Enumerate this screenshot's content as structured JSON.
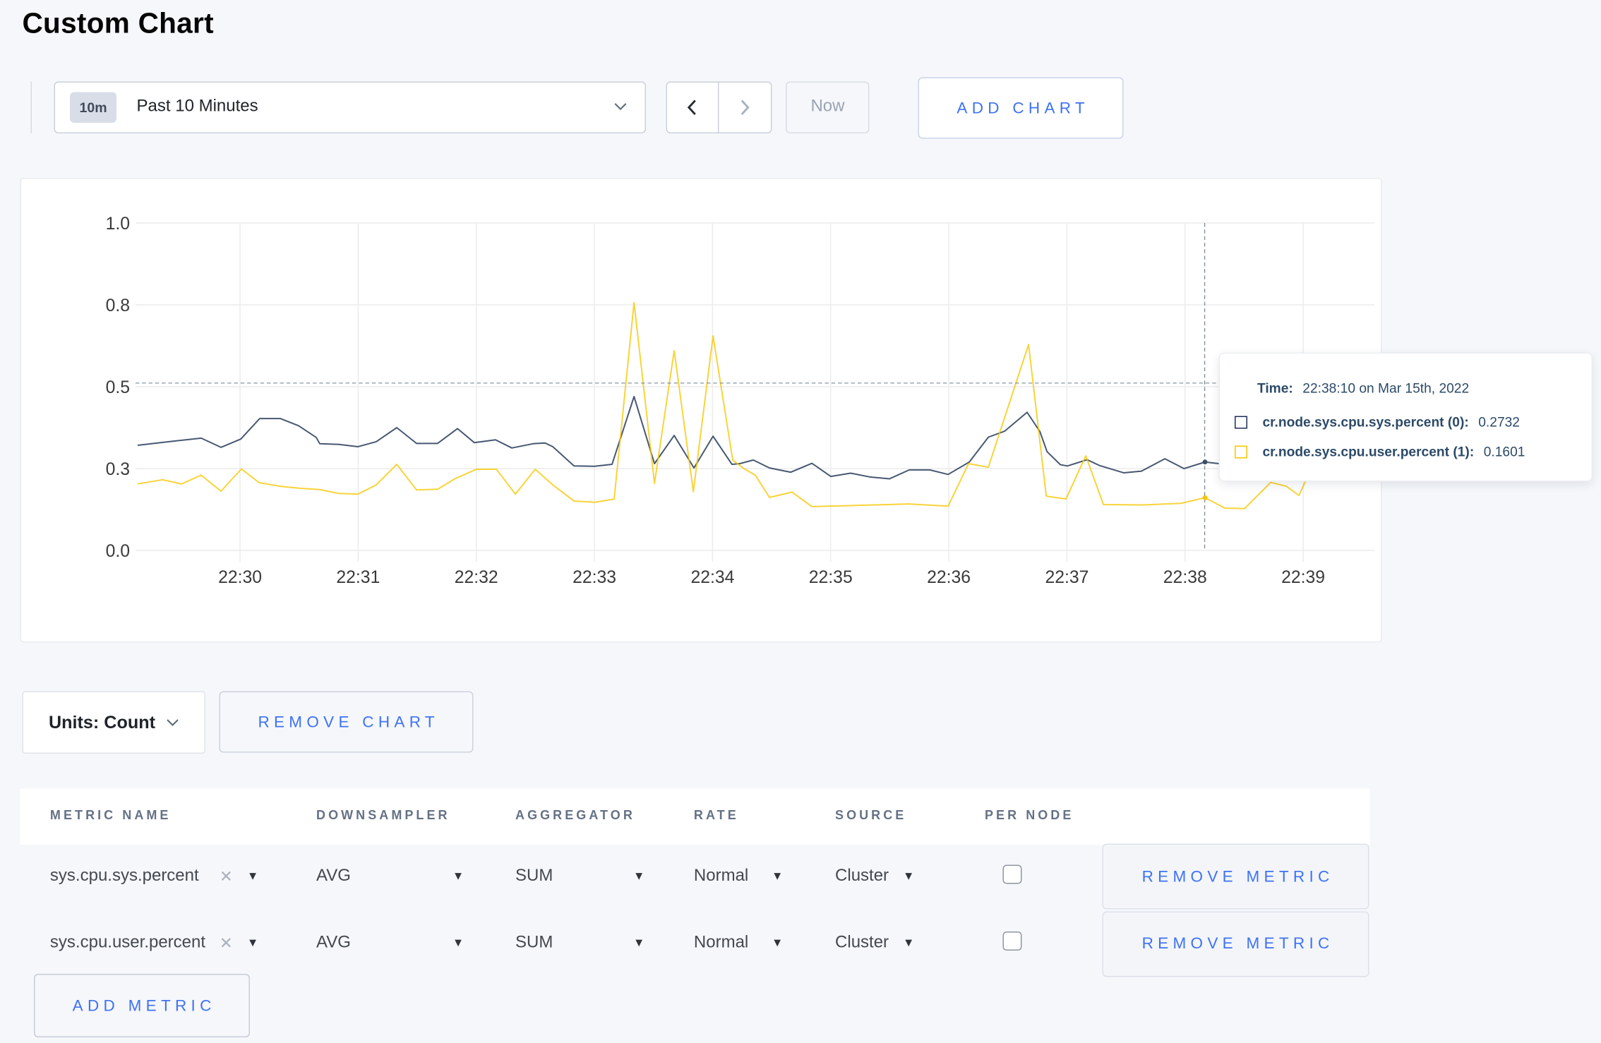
{
  "page": {
    "title": "Custom Chart"
  },
  "controls": {
    "time_badge": "10m",
    "time_label": "Past 10 Minutes",
    "now_label": "Now",
    "add_chart_label": "ADD CHART"
  },
  "chart_data": {
    "type": "line",
    "x_ticks": [
      "22:30",
      "22:31",
      "22:32",
      "22:33",
      "22:34",
      "22:35",
      "22:36",
      "22:37",
      "22:38",
      "22:39"
    ],
    "y_ticks": [
      "0.0",
      "0.3",
      "0.5",
      "0.8",
      "1.0"
    ],
    "ylim": [
      0,
      1
    ],
    "grid": true,
    "crosshair": {
      "time_minutes": 38.1667,
      "hline_value": 0.511
    },
    "series": [
      {
        "name": "cr.node.sys.cpu.sys.percent (0)",
        "color": "#475872",
        "hover_value": 0.2732,
        "points": [
          [
            29.133,
            0.321
          ],
          [
            29.444,
            0.334
          ],
          [
            29.671,
            0.343
          ],
          [
            29.839,
            0.315
          ],
          [
            30.006,
            0.34
          ],
          [
            30.167,
            0.403
          ],
          [
            30.341,
            0.403
          ],
          [
            30.496,
            0.381
          ],
          [
            30.645,
            0.345
          ],
          [
            30.675,
            0.326
          ],
          [
            30.837,
            0.324
          ],
          [
            30.998,
            0.317
          ],
          [
            31.153,
            0.332
          ],
          [
            31.327,
            0.375
          ],
          [
            31.494,
            0.327
          ],
          [
            31.673,
            0.327
          ],
          [
            31.841,
            0.372
          ],
          [
            31.984,
            0.329
          ],
          [
            32.163,
            0.338
          ],
          [
            32.301,
            0.313
          ],
          [
            32.48,
            0.326
          ],
          [
            32.582,
            0.328
          ],
          [
            32.648,
            0.317
          ],
          [
            32.827,
            0.258
          ],
          [
            33.0,
            0.257
          ],
          [
            33.149,
            0.263
          ],
          [
            33.335,
            0.47
          ],
          [
            33.508,
            0.265
          ],
          [
            33.675,
            0.351
          ],
          [
            33.843,
            0.252
          ],
          [
            34.004,
            0.349
          ],
          [
            34.165,
            0.263
          ],
          [
            34.231,
            0.265
          ],
          [
            34.345,
            0.276
          ],
          [
            34.482,
            0.252
          ],
          [
            34.661,
            0.239
          ],
          [
            34.841,
            0.266
          ],
          [
            35.002,
            0.226
          ],
          [
            35.169,
            0.236
          ],
          [
            35.337,
            0.224
          ],
          [
            35.498,
            0.219
          ],
          [
            35.665,
            0.246
          ],
          [
            35.839,
            0.246
          ],
          [
            35.994,
            0.232
          ],
          [
            36.173,
            0.27
          ],
          [
            36.335,
            0.346
          ],
          [
            36.472,
            0.364
          ],
          [
            36.663,
            0.422
          ],
          [
            36.771,
            0.363
          ],
          [
            36.831,
            0.302
          ],
          [
            36.944,
            0.262
          ],
          [
            37.004,
            0.258
          ],
          [
            37.171,
            0.277
          ],
          [
            37.279,
            0.259
          ],
          [
            37.482,
            0.237
          ],
          [
            37.631,
            0.242
          ],
          [
            37.829,
            0.28
          ],
          [
            37.99,
            0.25
          ],
          [
            38.169,
            0.27
          ],
          [
            38.367,
            0.262
          ],
          [
            38.576,
            0.285
          ],
          [
            38.785,
            0.272
          ],
          [
            38.994,
            0.298
          ],
          [
            39.203,
            0.282
          ],
          [
            39.412,
            0.29
          ]
        ]
      },
      {
        "name": "cr.node.sys.cpu.user.percent (1)",
        "color": "#f7c600",
        "hover_value": 0.1601,
        "points": [
          [
            29.133,
            0.203
          ],
          [
            29.343,
            0.216
          ],
          [
            29.504,
            0.203
          ],
          [
            29.671,
            0.23
          ],
          [
            29.839,
            0.181
          ],
          [
            30.012,
            0.249
          ],
          [
            30.161,
            0.207
          ],
          [
            30.341,
            0.196
          ],
          [
            30.496,
            0.19
          ],
          [
            30.675,
            0.186
          ],
          [
            30.837,
            0.174
          ],
          [
            30.998,
            0.172
          ],
          [
            31.153,
            0.2
          ],
          [
            31.327,
            0.263
          ],
          [
            31.494,
            0.185
          ],
          [
            31.673,
            0.187
          ],
          [
            31.823,
            0.22
          ],
          [
            32.002,
            0.248
          ],
          [
            32.17,
            0.248
          ],
          [
            32.331,
            0.172
          ],
          [
            32.498,
            0.248
          ],
          [
            32.648,
            0.2
          ],
          [
            32.827,
            0.151
          ],
          [
            33.006,
            0.147
          ],
          [
            33.167,
            0.157
          ],
          [
            33.335,
            0.757
          ],
          [
            33.508,
            0.205
          ],
          [
            33.675,
            0.61
          ],
          [
            33.837,
            0.179
          ],
          [
            34.004,
            0.655
          ],
          [
            34.171,
            0.276
          ],
          [
            34.261,
            0.251
          ],
          [
            34.363,
            0.23
          ],
          [
            34.482,
            0.162
          ],
          [
            34.673,
            0.178
          ],
          [
            34.841,
            0.134
          ],
          [
            34.99,
            0.135
          ],
          [
            35.66,
            0.142
          ],
          [
            35.994,
            0.135
          ],
          [
            36.167,
            0.265
          ],
          [
            36.335,
            0.254
          ],
          [
            36.675,
            0.629
          ],
          [
            36.825,
            0.166
          ],
          [
            36.992,
            0.157
          ],
          [
            37.159,
            0.289
          ],
          [
            37.309,
            0.14
          ],
          [
            37.649,
            0.139
          ],
          [
            37.966,
            0.144
          ],
          [
            38.169,
            0.161
          ],
          [
            38.337,
            0.129
          ],
          [
            38.504,
            0.128
          ],
          [
            38.725,
            0.208
          ],
          [
            38.857,
            0.196
          ],
          [
            38.964,
            0.168
          ],
          [
            39.072,
            0.252
          ],
          [
            39.203,
            0.295
          ],
          [
            39.412,
            0.27
          ]
        ]
      }
    ]
  },
  "tooltip": {
    "time_label": "Time:",
    "time_value": "22:38:10 on Mar 15th, 2022",
    "rows": [
      {
        "label": "cr.node.sys.cpu.sys.percent (0):",
        "value": "0.2732"
      },
      {
        "label": "cr.node.sys.cpu.user.percent (1):",
        "value": "0.1601"
      }
    ]
  },
  "units": {
    "label": "Units: Count"
  },
  "remove_chart_label": "REMOVE CHART",
  "metrics_table": {
    "headers": [
      "METRIC NAME",
      "DOWNSAMPLER",
      "AGGREGATOR",
      "RATE",
      "SOURCE",
      "PER NODE"
    ],
    "rows": [
      {
        "metric": "sys.cpu.sys.percent",
        "downsampler": "AVG",
        "aggregator": "SUM",
        "rate": "Normal",
        "source": "Cluster",
        "per_node_checked": false,
        "remove_label": "REMOVE METRIC"
      },
      {
        "metric": "sys.cpu.user.percent",
        "downsampler": "AVG",
        "aggregator": "SUM",
        "rate": "Normal",
        "source": "Cluster",
        "per_node_checked": false,
        "remove_label": "REMOVE METRIC"
      }
    ],
    "add_metric_label": "ADD METRIC"
  }
}
